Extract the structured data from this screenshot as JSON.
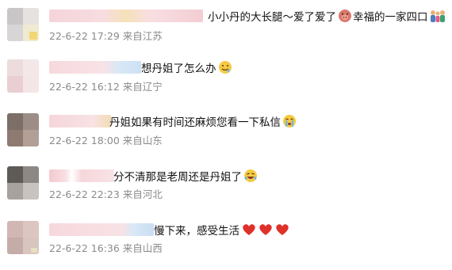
{
  "comments": [
    {
      "text": "小小丹的大长腿～爱了爱了",
      "text2": "幸福的一家四口",
      "date": "22-6-22",
      "time": "17:29",
      "location": "来自江苏",
      "emoji1": "pig-face-icon",
      "emoji2": "family-icon"
    },
    {
      "text": "想丹姐了怎么办",
      "date": "22-6-22",
      "time": "16:12",
      "location": "来自辽宁",
      "emoji1": "drooling-face-icon"
    },
    {
      "text": "丹姐如果有时间还麻烦您看一下私信",
      "date": "22-6-22",
      "time": "18:00",
      "location": "来自山东",
      "emoji1": "crying-face-icon"
    },
    {
      "text": "分不清那是老周还是丹姐了",
      "date": "22-6-22",
      "time": "22:23",
      "location": "来自河北",
      "emoji1": "laughing-face-icon"
    },
    {
      "text": "慢下来，感受生活",
      "date": "22-6-22",
      "time": "16:36",
      "location": "来自山西",
      "emoji1": "red-heart-icon"
    }
  ]
}
